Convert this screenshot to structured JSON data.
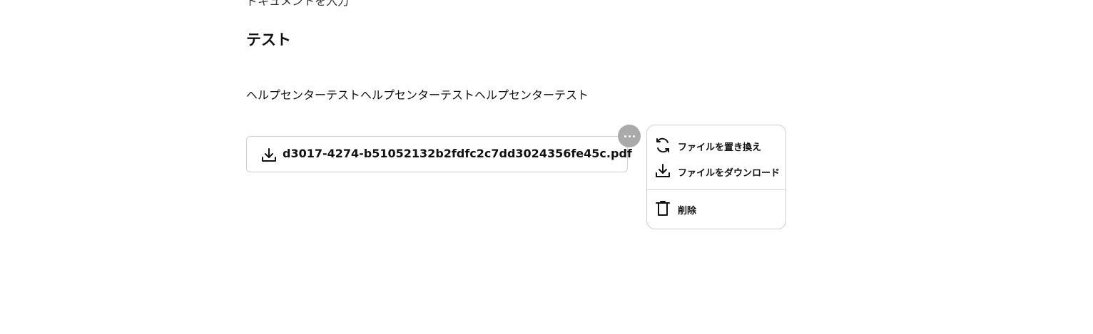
{
  "section": {
    "cut_text": "ドキュメントを入力",
    "heading": "テスト",
    "body": "ヘルプセンターテストヘルプセンターテストヘルプセンターテスト"
  },
  "attachment": {
    "file_name": "d3017-4274-b51052132b2fdfc2c7dd3024356fe45c.pdf",
    "icon": "download-icon"
  },
  "more_button": {
    "icon": "more-horizontal-icon"
  },
  "context_menu": {
    "items": [
      {
        "label": "ファイルを置き換え",
        "icon": "refresh-icon"
      },
      {
        "label": "ファイルをダウンロード",
        "icon": "download-icon"
      },
      {
        "label": "削除",
        "icon": "trash-icon"
      }
    ]
  },
  "colors": {
    "text": "#111111",
    "border": "#cfcfcf",
    "more_button_bg": "#aaaaaa"
  }
}
